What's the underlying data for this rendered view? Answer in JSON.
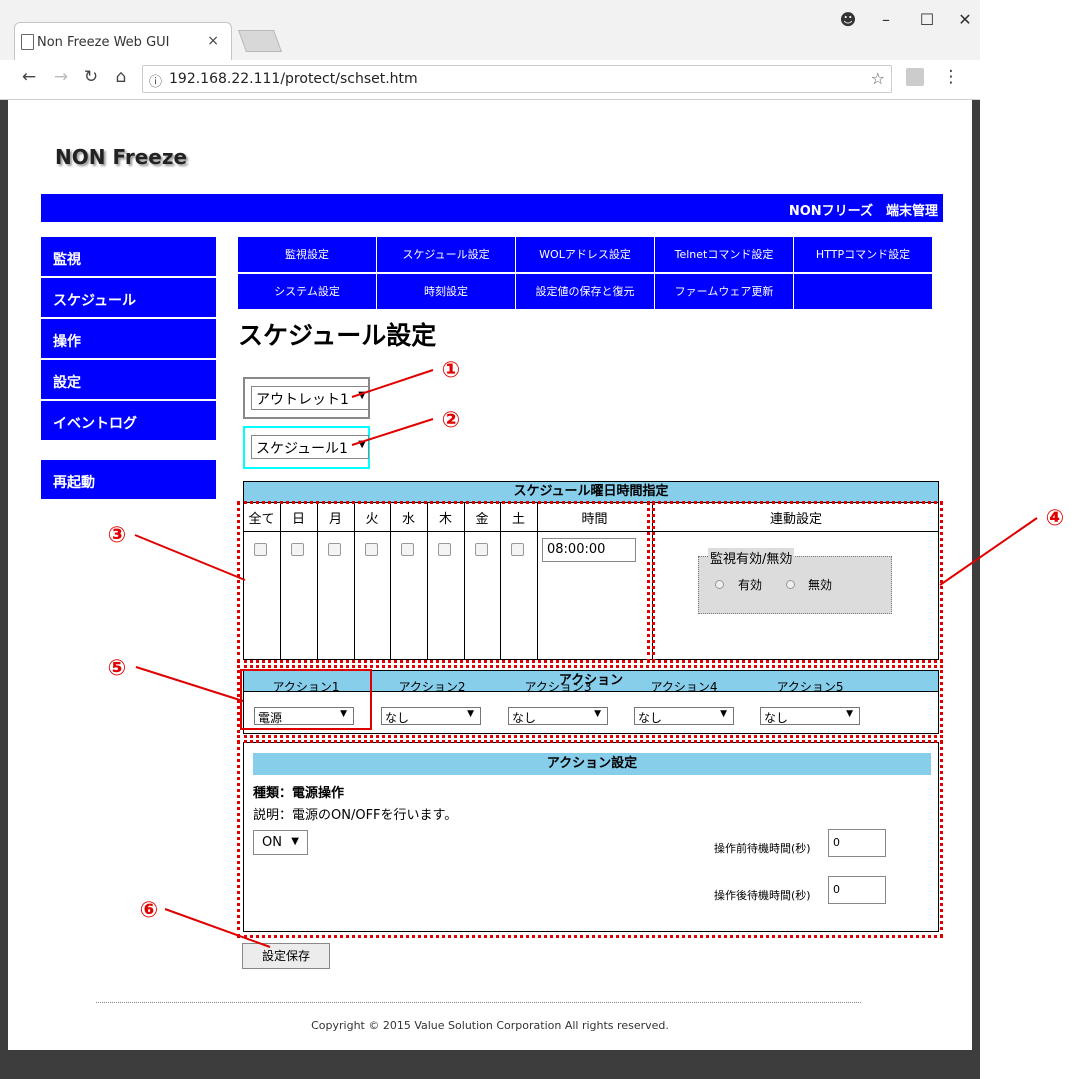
{
  "browser": {
    "tab_title": "Non Freeze Web GUI",
    "tab_close": "×",
    "url": "192.168.22.111/protect/schset.htm"
  },
  "page": {
    "logo": "NON Freeze",
    "header_right": "NONフリーズ　端末管理",
    "title": "スケジュール設定"
  },
  "sidebar": {
    "items": [
      {
        "label": "監視"
      },
      {
        "label": "スケジュール"
      },
      {
        "label": "操作"
      },
      {
        "label": "設定"
      },
      {
        "label": "イベントログ"
      }
    ],
    "restart": "再起動"
  },
  "menu": {
    "row1": [
      "監視設定",
      "スケジュール設定",
      "WOLアドレス設定",
      "Telnetコマンド設定",
      "HTTPコマンド設定"
    ],
    "row2": [
      "システム設定",
      "時刻設定",
      "設定値の保存と復元",
      "ファームウェア更新"
    ]
  },
  "selectors": {
    "outlet": "アウトレット1",
    "schedule": "スケジュール1"
  },
  "schedule": {
    "header": "スケジュール曜日時間指定",
    "days": [
      "全て",
      "日",
      "月",
      "火",
      "水",
      "木",
      "金",
      "土"
    ],
    "time_label": "時間",
    "time_value": "08:00:00",
    "link_label": "連動設定",
    "monitor_legend": "監視有効/無効",
    "enabled_label": "有効",
    "disabled_label": "無効"
  },
  "actions": {
    "header": "アクション",
    "labels": [
      "アクション1",
      "アクション2",
      "アクション3",
      "アクション4",
      "アクション5"
    ],
    "values": [
      "電源",
      "なし",
      "なし",
      "なし",
      "なし"
    ]
  },
  "action_setting": {
    "header": "アクション設定",
    "type_line": "種類：電源操作",
    "desc_line": "説明：電源のON/OFFを行います。",
    "on_value": "ON",
    "pre_wait_label": "操作前待機時間(秒)",
    "pre_wait_value": "0",
    "post_wait_label": "操作後待機時間(秒)",
    "post_wait_value": "0"
  },
  "save_button": "設定保存",
  "copyright": "Copyright © 2015 Value Solution Corporation All rights reserved.",
  "callouts": [
    "①",
    "②",
    "③",
    "④",
    "⑤",
    "⑥"
  ],
  "colors": {
    "nav_blue": "#0000ff",
    "header_sky": "#87ceeb",
    "callout_red": "#e00000"
  }
}
